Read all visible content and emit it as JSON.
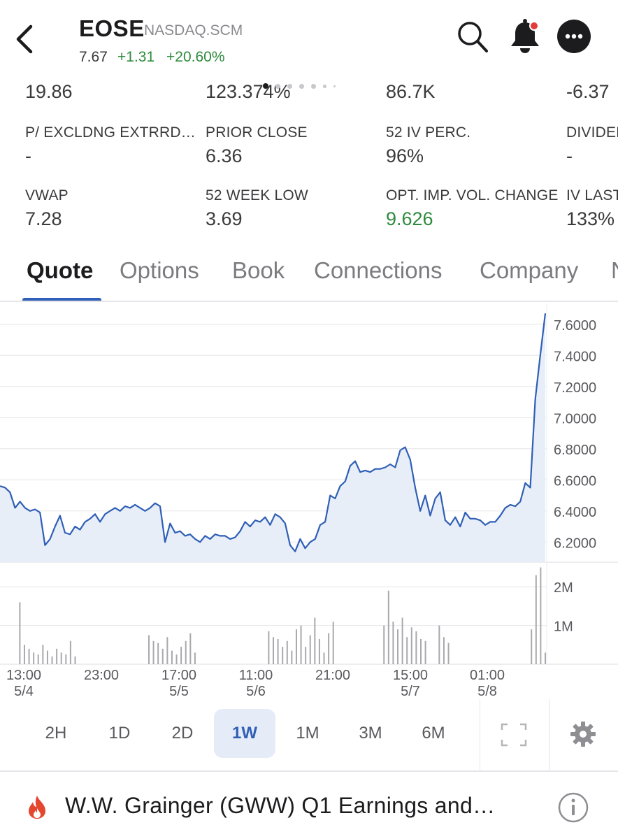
{
  "header": {
    "ticker": "EOSE",
    "exchange": "NASDAQ.SCM",
    "price": "7.67",
    "change": "+1.31",
    "change_pct": "+20.60%"
  },
  "stats_partial_row": [
    "19.86",
    "123.374%",
    "86.7K",
    "-6.37"
  ],
  "stats": [
    {
      "label": "P/ EXCLDNG EXTRRD…",
      "value": "-"
    },
    {
      "label": "PRIOR CLOSE",
      "value": "6.36"
    },
    {
      "label": "52 IV PERC.",
      "value": "96%"
    },
    {
      "label": "DIVIDEN",
      "value": "-"
    },
    {
      "label": "VWAP",
      "value": "7.28"
    },
    {
      "label": "52 WEEK LOW",
      "value": "3.69"
    },
    {
      "label": "OPT. IMP. VOL. CHANGE",
      "value": "9.626",
      "color": "#2e8b3e"
    },
    {
      "label": "IV LAST",
      "value": "133%"
    }
  ],
  "tabs": [
    "Quote",
    "Options",
    "Book",
    "Connections",
    "Company",
    "N"
  ],
  "active_tab": "Quote",
  "chart_data": {
    "type": "line",
    "price_axis_labels": [
      "7.6000",
      "7.4000",
      "7.2000",
      "7.0000",
      "6.8000",
      "6.6000",
      "6.4000",
      "6.2000"
    ],
    "price_ylim": [
      6.08,
      7.68
    ],
    "volume_axis_labels": [
      "2M",
      "1M"
    ],
    "volume_ylim": [
      0,
      2600000
    ],
    "x_ticks": [
      {
        "time": "13:00",
        "date": "5/4"
      },
      {
        "time": "23:00",
        "date": ""
      },
      {
        "time": "17:00",
        "date": "5/5"
      },
      {
        "time": "11:00",
        "date": "5/6"
      },
      {
        "time": "21:00",
        "date": ""
      },
      {
        "time": "15:00",
        "date": "5/7"
      },
      {
        "time": "01:00",
        "date": "5/8"
      }
    ],
    "price_series": [
      6.56,
      6.55,
      6.52,
      6.42,
      6.46,
      6.42,
      6.4,
      6.41,
      6.39,
      6.18,
      6.22,
      6.3,
      6.37,
      6.26,
      6.25,
      6.3,
      6.28,
      6.33,
      6.35,
      6.38,
      6.33,
      6.38,
      6.4,
      6.42,
      6.4,
      6.43,
      6.42,
      6.44,
      6.42,
      6.4,
      6.42,
      6.45,
      6.43,
      6.2,
      6.32,
      6.26,
      6.27,
      6.24,
      6.25,
      6.22,
      6.2,
      6.24,
      6.22,
      6.25,
      6.24,
      6.24,
      6.22,
      6.23,
      6.27,
      6.33,
      6.3,
      6.34,
      6.33,
      6.36,
      6.31,
      6.38,
      6.36,
      6.32,
      6.18,
      6.14,
      6.22,
      6.16,
      6.2,
      6.22,
      6.31,
      6.33,
      6.5,
      6.48,
      6.56,
      6.59,
      6.69,
      6.72,
      6.65,
      6.66,
      6.65,
      6.67,
      6.67,
      6.68,
      6.7,
      6.68,
      6.79,
      6.81,
      6.73,
      6.55,
      6.4,
      6.5,
      6.37,
      6.48,
      6.52,
      6.34,
      6.31,
      6.36,
      6.3,
      6.39,
      6.35,
      6.35,
      6.34,
      6.31,
      6.33,
      6.33,
      6.37,
      6.42,
      6.44,
      6.43,
      6.46,
      6.58,
      6.55,
      7.12,
      7.4,
      7.67
    ],
    "volume_series": [
      0,
      0,
      0,
      0,
      1600000,
      500000,
      400000,
      300000,
      250000,
      500000,
      350000,
      200000,
      400000,
      300000,
      250000,
      600000,
      200000,
      0,
      0,
      0,
      0,
      0,
      0,
      0,
      0,
      0,
      0,
      0,
      0,
      0,
      0,
      0,
      750000,
      600000,
      550000,
      400000,
      700000,
      350000,
      250000,
      450000,
      600000,
      800000,
      300000,
      0,
      0,
      0,
      0,
      0,
      0,
      0,
      0,
      0,
      0,
      0,
      0,
      0,
      0,
      0,
      850000,
      700000,
      650000,
      450000,
      600000,
      350000,
      900000,
      1000000,
      450000,
      750000,
      1200000,
      650000,
      300000,
      800000,
      1100000,
      0,
      0,
      0,
      0,
      0,
      0,
      0,
      0,
      0,
      0,
      1000000,
      1900000,
      1100000,
      900000,
      1200000,
      700000,
      950000,
      850000,
      650000,
      600000,
      0,
      0,
      1000000,
      700000,
      550000,
      0,
      0,
      0,
      0,
      0,
      0,
      0,
      0,
      0,
      0,
      0,
      0,
      0,
      0,
      0,
      0,
      0,
      900000,
      2300000,
      2500000,
      300000
    ]
  },
  "ranges": [
    "2H",
    "1D",
    "2D",
    "1W",
    "1M",
    "3M",
    "6M"
  ],
  "active_range": "1W",
  "news": {
    "headline": "W.W. Grainger (GWW) Q1 Earnings and…"
  },
  "colors": {
    "accent": "#2f5fb6",
    "positive": "#2e8b3e",
    "line": "#2f5fb6",
    "fill": "#e8eef8",
    "volume": "#a9a9ad",
    "fire": "#e4472f"
  },
  "icons": {
    "back": "chevron-left-icon",
    "search": "search-icon",
    "bell": "bell-icon",
    "more": "more-icon",
    "expand": "expand-icon",
    "settings": "gear-icon",
    "fire": "fire-icon",
    "info": "info-icon"
  }
}
